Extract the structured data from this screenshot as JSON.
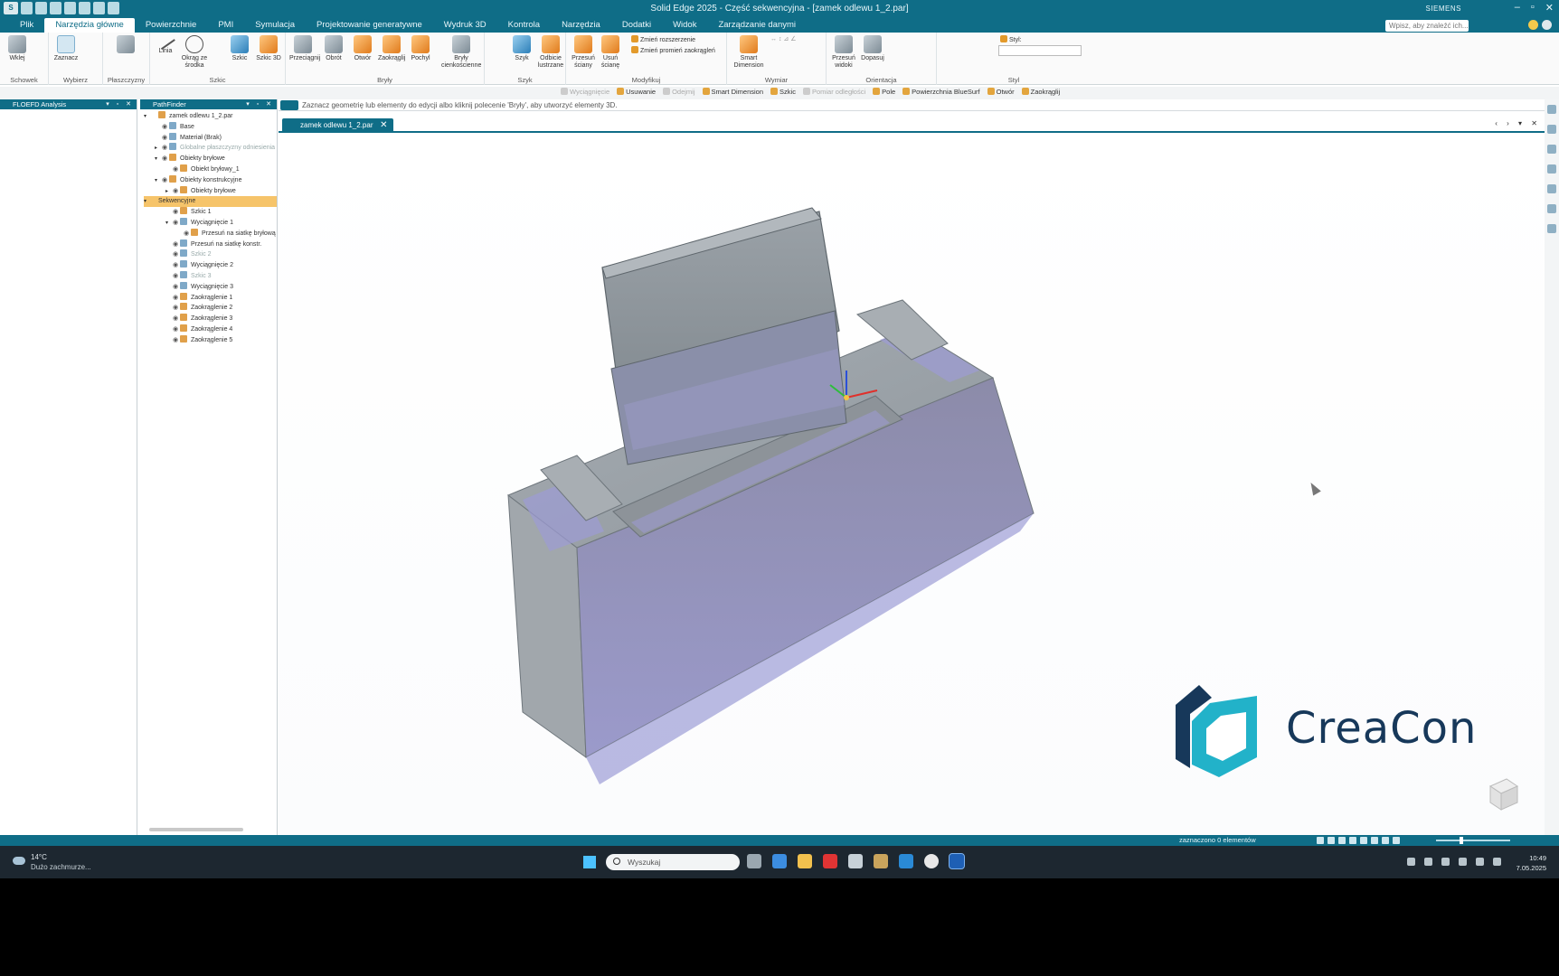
{
  "window": {
    "title": "Solid Edge 2025 - Część sekwencyjna - [zamek odlewu 1_2.par]",
    "brand": "SIEMENS",
    "controls": [
      "–",
      "▫",
      "✕"
    ]
  },
  "menu": {
    "tabs": [
      "Plik",
      "Narzędzia główne",
      "Powierzchnie",
      "PMI",
      "Symulacja",
      "Projektowanie generatywne",
      "Wydruk 3D",
      "Kontrola",
      "Narzędzia",
      "Dodatki",
      "Widok",
      "Zarządzanie danymi"
    ],
    "active_index": 1,
    "search_placeholder": "Wpisz, aby znaleźć ich..."
  },
  "ribbon": {
    "groups": [
      {
        "label": "Schowek",
        "buttons": [
          "Wklej"
        ]
      },
      {
        "label": "Wybierz",
        "buttons": [
          "Zaznacz"
        ]
      },
      {
        "label": "Płaszczyzny",
        "buttons": [
          ""
        ]
      },
      {
        "label": "Szkic",
        "buttons": [
          "Linia",
          "Okrąg ze środka",
          "Szkic",
          "Szkic 3D"
        ]
      },
      {
        "label": "Bryły",
        "buttons": [
          "Przeciągnij",
          "Obrót",
          "Otwór",
          "Zaokrąglij",
          "Pochyl",
          "Bryły cienkościenne"
        ]
      },
      {
        "label": "Szyk",
        "buttons": [
          "Szyk",
          "Odbicie lustrzane"
        ]
      },
      {
        "label": "Modyfikuj",
        "buttons": [
          "Przesuń ściany",
          "Usuń ścianę"
        ],
        "small": [
          "Zmień rozszerzenie",
          "Zmień promień zaokrągleń"
        ]
      },
      {
        "label": "Wymiar",
        "buttons": [
          "Smart Dimension"
        ]
      },
      {
        "label": "Orientacja",
        "buttons": [
          "Przesuń widoki",
          "Dopasuj"
        ]
      },
      {
        "label": "Styl",
        "buttons": [],
        "small": [
          "Styl:"
        ]
      }
    ]
  },
  "command_bar": {
    "items": [
      {
        "label": "Wyciągnięcie",
        "enabled": false
      },
      {
        "label": "Usuwanie",
        "enabled": true
      },
      {
        "label": "Odejmij",
        "enabled": false
      },
      {
        "label": "Smart Dimension",
        "enabled": true
      },
      {
        "label": "Szkic",
        "enabled": true
      },
      {
        "label": "Pomiar odległości",
        "enabled": false
      },
      {
        "label": "Pole",
        "enabled": true
      },
      {
        "label": "Powierzchnia BlueSurf",
        "enabled": true
      },
      {
        "label": "Otwór",
        "enabled": true
      },
      {
        "label": "Zaokrąglij",
        "enabled": true
      }
    ]
  },
  "panels": {
    "left_title": "FLOEFD Analysis",
    "pathfinder_title": "PathFinder",
    "tree": [
      {
        "label": "zamek odlewu 1_2.par",
        "level": 0,
        "twisty": "▾",
        "icon": "part",
        "state": ""
      },
      {
        "label": "Base",
        "level": 1,
        "twisty": "",
        "icon": "feat",
        "state": ""
      },
      {
        "label": "Materiał (Brak)",
        "level": 1,
        "twisty": "",
        "icon": "feat",
        "state": ""
      },
      {
        "label": "Globalne płaszczyzny odniesienia",
        "level": 1,
        "twisty": "▸",
        "icon": "feat",
        "state": "dim"
      },
      {
        "label": "Obiekty bryłowe",
        "level": 1,
        "twisty": "▾",
        "icon": "part",
        "state": ""
      },
      {
        "label": "Obiekt bryłowy_1",
        "level": 2,
        "twisty": "",
        "icon": "part",
        "state": ""
      },
      {
        "label": "Obiekty konstrukcyjne",
        "level": 1,
        "twisty": "▾",
        "icon": "part",
        "state": ""
      },
      {
        "label": "Obiekty bryłowe",
        "level": 2,
        "twisty": "▸",
        "icon": "part",
        "state": ""
      },
      {
        "label": "Sekwencyjne",
        "level": 0,
        "twisty": "▾",
        "icon": "",
        "state": "sel"
      },
      {
        "label": "Szkic 1",
        "level": 2,
        "twisty": "",
        "icon": "part",
        "state": ""
      },
      {
        "label": "Wyciągnięcie 1",
        "level": 2,
        "twisty": "▾",
        "icon": "feat",
        "state": ""
      },
      {
        "label": "Przesuń na siatkę bryłową",
        "level": 3,
        "twisty": "",
        "icon": "part",
        "state": ""
      },
      {
        "label": "Przesuń na siatkę konstr.",
        "level": 2,
        "twisty": "",
        "icon": "feat",
        "state": ""
      },
      {
        "label": "Szkic 2",
        "level": 2,
        "twisty": "",
        "icon": "feat",
        "state": "dim"
      },
      {
        "label": "Wyciągnięcie 2",
        "level": 2,
        "twisty": "",
        "icon": "feat",
        "state": ""
      },
      {
        "label": "Szkic 3",
        "level": 2,
        "twisty": "",
        "icon": "feat",
        "state": "dim"
      },
      {
        "label": "Wyciągnięcie 3",
        "level": 2,
        "twisty": "",
        "icon": "feat",
        "state": ""
      },
      {
        "label": "Zaokrąglenie 1",
        "level": 2,
        "twisty": "",
        "icon": "part",
        "state": ""
      },
      {
        "label": "Zaokrąglenie 2",
        "level": 2,
        "twisty": "",
        "icon": "part",
        "state": ""
      },
      {
        "label": "Zaokrąglenie 3",
        "level": 2,
        "twisty": "",
        "icon": "part",
        "state": ""
      },
      {
        "label": "Zaokrąglenie 4",
        "level": 2,
        "twisty": "",
        "icon": "part",
        "state": ""
      },
      {
        "label": "Zaokrąglenie 5",
        "level": 2,
        "twisty": "",
        "icon": "part",
        "state": ""
      }
    ]
  },
  "prompt": "Zaznacz geometrię lub elementy do edycji albo kliknij polecenie 'Bryły', aby utworzyć elementy 3D.",
  "document_tab": "zamek odlewu 1_2.par",
  "logo": {
    "text": "CreaCon"
  },
  "status": {
    "message": "zaznaczono 0 elementów"
  },
  "taskbar": {
    "weather_temp": "14°C",
    "weather_desc": "Dużo zachmurze...",
    "search_placeholder": "Wyszukaj",
    "time": "10:49",
    "date": "7.05.2025"
  },
  "colors": {
    "accent": "#0f6d87",
    "selected_node": "#f6c46a",
    "model_gray": "#8e969c",
    "model_purple": "#9a99cf",
    "logo_dark": "#17385a",
    "logo_teal": "#22b2c9"
  }
}
